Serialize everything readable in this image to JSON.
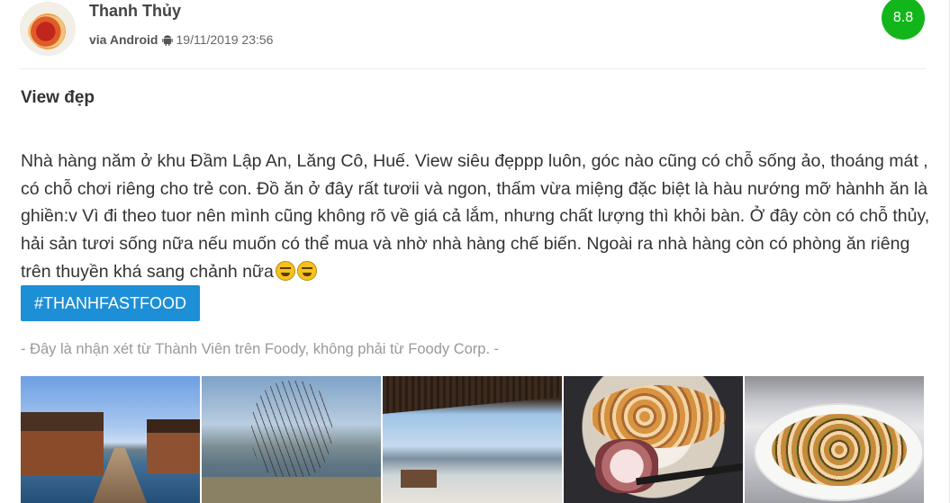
{
  "header": {
    "user_name": "Thanh Thủy",
    "via_label": "via Android",
    "timestamp": "19/11/2019 23:56",
    "score": "8.8",
    "score_color": "#13b61a",
    "avatar_icon": "food-avatar",
    "platform_icon": "android-icon"
  },
  "review": {
    "title": "View đẹp",
    "body": "Nhà hàng năm ở khu Đầm Lập An, Lăng Cô, Huế. View siêu đẹppp luôn, góc nào cũng có chỗ sống ảo, thoáng mát , có chỗ chơi riêng cho trẻ con. Đồ ăn ở đây rất tươii và ngon, thấm vừa miệng đặc biệt là hàu nướng mỡ hànhh ăn là ghiền:v Vì đi theo tuor nên mình cũng không rõ về giá cả lắm, nhưng chất lượng thì khỏi bàn. Ở đây còn có chỗ thủy, hải sản tươi sống nữa nếu muốn có thể mua và nhờ nhà hàng chế biến. Ngoài ra nhà hàng còn có phòng ăn riêng trên thuyền khá sang chảnh nữa",
    "emoji_icons": [
      "laughing-emoji-icon",
      "laughing-emoji-icon"
    ],
    "hashtag": "#THANHFASTFOOD",
    "hashtag_color": "#1d8fd6",
    "disclaimer": "- Đây là nhận xét từ Thành Viên trên Foody, không phải từ Foody Corp. -"
  },
  "photos": [
    "lake-huts-photo",
    "lake-tree-photo",
    "lake-view-photo",
    "seafood-octopus-photo",
    "clams-plate-photo"
  ]
}
